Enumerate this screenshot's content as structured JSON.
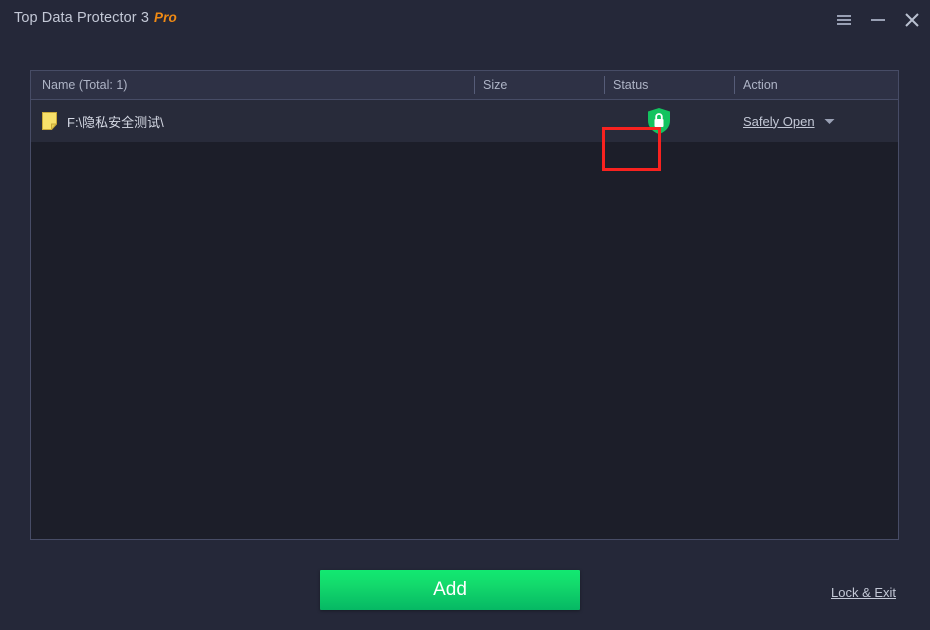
{
  "window": {
    "title": "Top Data Protector 3",
    "title_badge": "Pro",
    "background_color": "#252839",
    "accent_color": "#f08a14",
    "controls": {
      "menu_icon": "hamburger-menu-icon",
      "minimize_icon": "minimize-icon",
      "close_icon": "close-icon"
    }
  },
  "list": {
    "columns": [
      {
        "key": "name",
        "label": "Name (Total: 1)"
      },
      {
        "key": "size",
        "label": "Size"
      },
      {
        "key": "status",
        "label": "Status"
      },
      {
        "key": "action",
        "label": "Action"
      }
    ],
    "rows": [
      {
        "icon": "folder-icon",
        "name": "F:\\隐私安全测试\\",
        "size": "",
        "status_icon": "shield-lock-icon",
        "status_color": "#13c35f",
        "action_label": "Safely Open",
        "action_caret": "chevron-down-icon"
      }
    ],
    "total_count": 1
  },
  "annotation": {
    "highlight_color": "#f8221f",
    "target": "status-shield-icon"
  },
  "footer": {
    "add_label": "Add",
    "add_color": "#12e971",
    "lock_exit_label": "Lock & Exit"
  }
}
